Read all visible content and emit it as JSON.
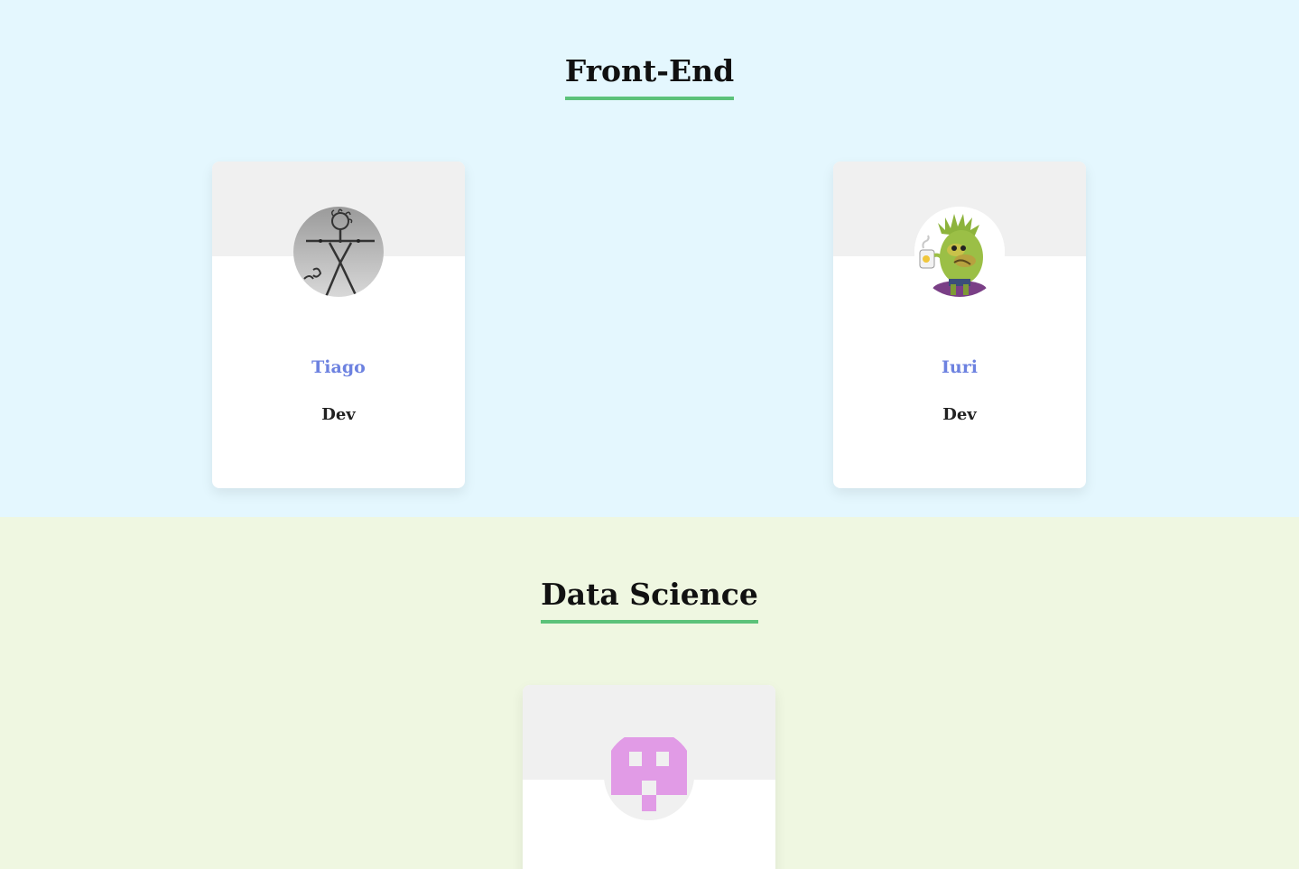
{
  "sections": [
    {
      "title": "Front-End",
      "members": [
        {
          "name": "Tiago",
          "role": "Dev",
          "avatar_icon": "stick-figure-avatar-icon"
        },
        {
          "name": "Iuri",
          "role": "Dev",
          "avatar_icon": "green-monster-avatar-icon"
        }
      ]
    },
    {
      "title": "Data Science",
      "members": [
        {
          "avatar_icon": "pink-identicon-avatar-icon"
        }
      ]
    }
  ],
  "colors": {
    "frontend_bg": "#e4f7fe",
    "datascience_bg": "#eff7e1",
    "title_underline": "#5cc27a",
    "name_link": "#6d82e0",
    "identicon": "#e19be6"
  }
}
